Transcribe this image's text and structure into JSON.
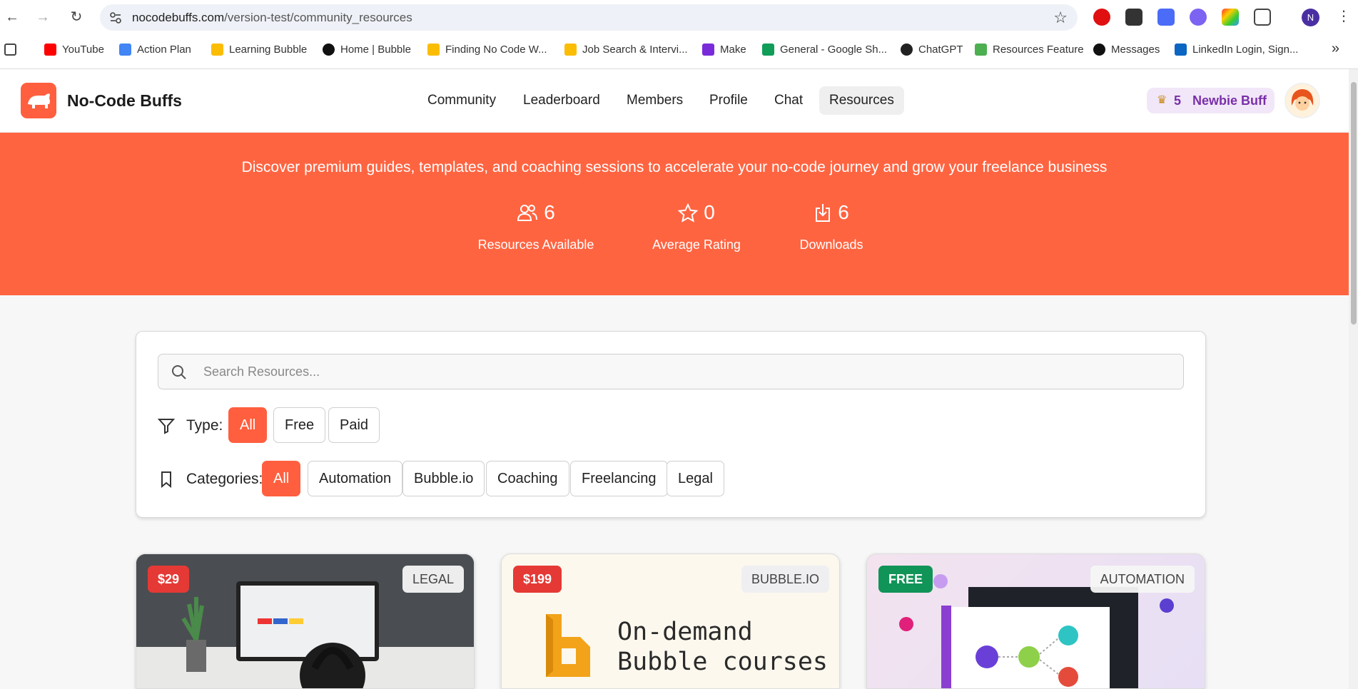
{
  "browser": {
    "url_host": "nocodebuffs.com",
    "url_path": "/version-test/community_resources",
    "profile_initial": "N",
    "bookmarks": [
      {
        "label": "YouTube",
        "color": "#ff0000"
      },
      {
        "label": "Action Plan",
        "color": "#4285f4"
      },
      {
        "label": "Learning Bubble",
        "color": "#0f9d58"
      },
      {
        "label": "Home | Bubble",
        "color": "#111111"
      },
      {
        "label": "Finding No Code W...",
        "color": "#0f9d58"
      },
      {
        "label": "Job Search & Intervi...",
        "color": "#0f9d58"
      },
      {
        "label": "Make",
        "color": "#7a2bd9"
      },
      {
        "label": "General - Google Sh...",
        "color": "#0f9d58"
      },
      {
        "label": "ChatGPT",
        "color": "#222222"
      },
      {
        "label": "Resources Feature",
        "color": "#4caf50"
      },
      {
        "label": "Messages",
        "color": "#111111"
      },
      {
        "label": "LinkedIn Login, Sign...",
        "color": "#0a66c2"
      }
    ]
  },
  "app": {
    "brand": "No-Code Buffs",
    "nav": [
      "Community",
      "Leaderboard",
      "Members",
      "Profile",
      "Chat",
      "Resources"
    ],
    "active_nav": "Resources",
    "badge": {
      "points": "5",
      "label": "Newbie Buff"
    }
  },
  "hero": {
    "subtitle": "Discover premium guides, templates, and coaching sessions to accelerate your no-code journey and grow your freelance business",
    "stats": [
      {
        "value": "6",
        "label": "Resources Available",
        "icon": "users-icon"
      },
      {
        "value": "0",
        "label": "Average Rating",
        "icon": "star-icon"
      },
      {
        "value": "6",
        "label": "Downloads",
        "icon": "download-icon"
      }
    ]
  },
  "filters": {
    "search_placeholder": "Search Resources...",
    "type_label": "Type:",
    "types": [
      "All",
      "Free",
      "Paid"
    ],
    "categories_label": "Categories:",
    "categories": [
      "All",
      "Automation",
      "Bubble.io",
      "Coaching",
      "Freelancing",
      "Legal"
    ]
  },
  "cards": [
    {
      "price": "$29",
      "category": "LEGAL"
    },
    {
      "price": "$199",
      "category": "BUBBLE.IO",
      "image_text_1": "On-demand",
      "image_text_2": "Bubble courses"
    },
    {
      "price": "FREE",
      "category": "AUTOMATION"
    }
  ],
  "colors": {
    "accent": "#ff6441",
    "active_chip": "#ff5f3f",
    "badge_text": "#7a2fa8",
    "paid_badge": "#e53935",
    "free_badge": "#109457"
  }
}
